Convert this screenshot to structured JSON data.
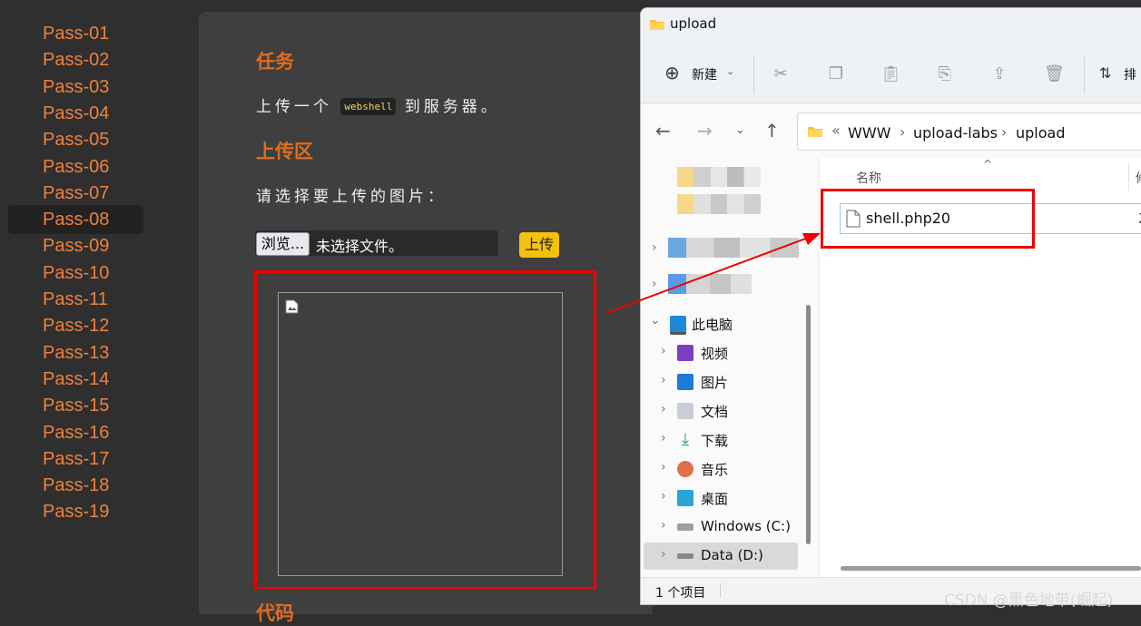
{
  "sidebar": {
    "items": [
      "Pass-01",
      "Pass-02",
      "Pass-03",
      "Pass-04",
      "Pass-05",
      "Pass-06",
      "Pass-07",
      "Pass-08",
      "Pass-09",
      "Pass-10",
      "Pass-11",
      "Pass-12",
      "Pass-13",
      "Pass-14",
      "Pass-15",
      "Pass-16",
      "Pass-17",
      "Pass-18",
      "Pass-19"
    ],
    "active": "Pass-08"
  },
  "main": {
    "task_heading": "任务",
    "task_pre": "上传一个",
    "task_code": "webshell",
    "task_post": "到服务器。",
    "upload_heading": "上传区",
    "choose_text": "请选择要上传的图片：",
    "browse_label": "浏览...",
    "no_file_label": "未选择文件。",
    "upload_button": "上传",
    "code_heading": "代码"
  },
  "explorer": {
    "title": "upload",
    "toolbar": {
      "new_label": "新建",
      "sort_label": "排"
    },
    "breadcrumb": [
      "WWW",
      "upload-labs",
      "upload"
    ],
    "breadcrumb_prefix": "«",
    "nav": {
      "this_pc": "此电脑",
      "items": [
        "视频",
        "图片",
        "文档",
        "下载",
        "音乐",
        "桌面",
        "Windows (C:)",
        "Data (D:)"
      ]
    },
    "columns": {
      "name": "名称",
      "modified": "修"
    },
    "file": {
      "name": "shell.php20",
      "date_prefix": "2"
    },
    "status": "1 个项目"
  },
  "watermark": "CSDN @黑色地带(崛起)",
  "colors": {
    "accent_orange": "#f0803c",
    "heading_orange": "#e26b1c",
    "highlight_red": "#ee0000",
    "upload_yellow": "#f4c20d"
  }
}
